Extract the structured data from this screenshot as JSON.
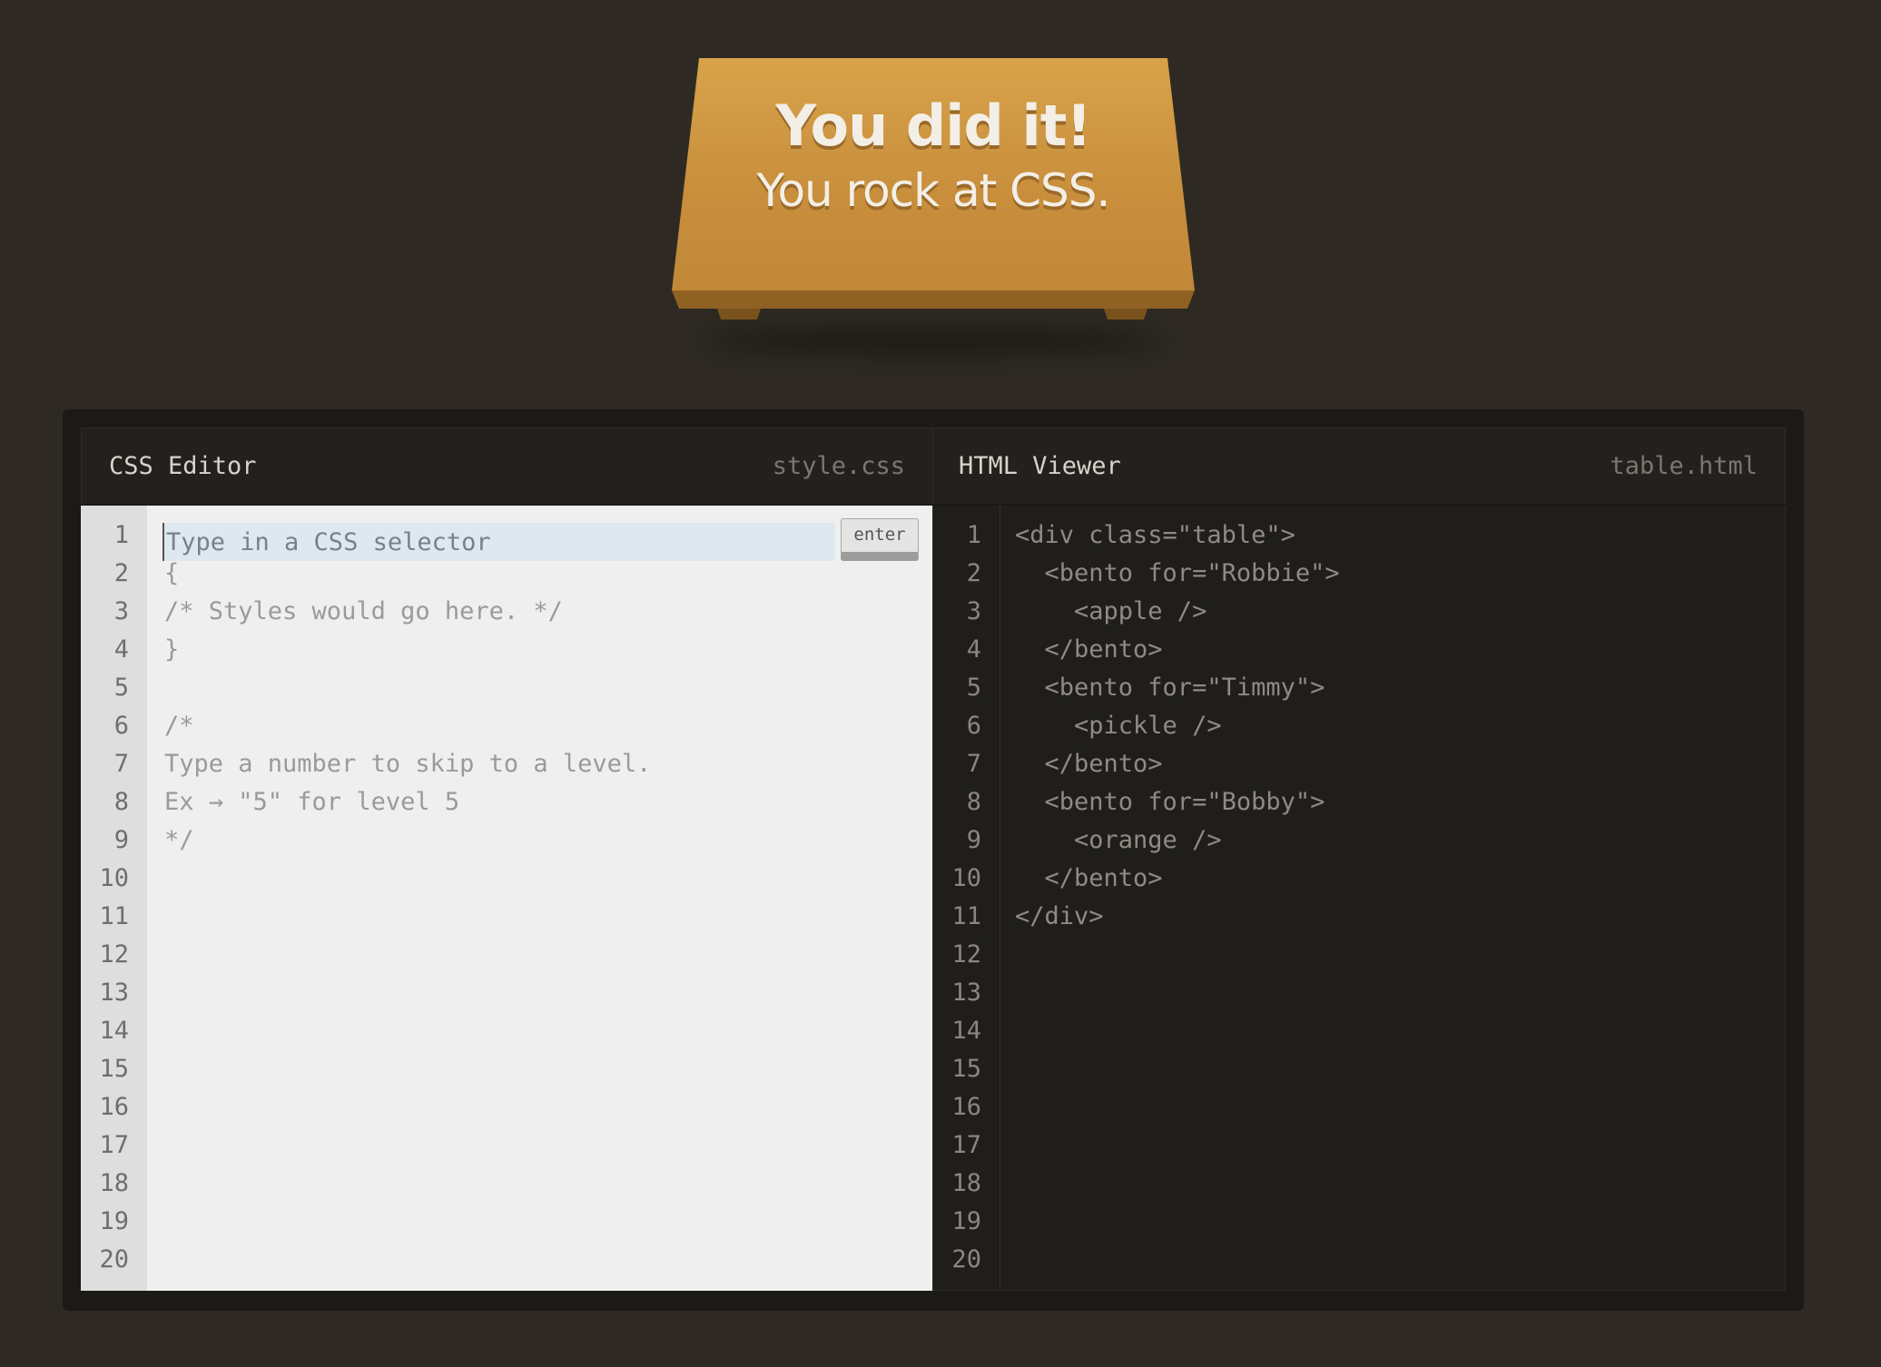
{
  "banner": {
    "title": "You did it!",
    "subtitle": "You rock at CSS."
  },
  "css_editor": {
    "title": "CSS Editor",
    "filename": "style.css",
    "input_placeholder": "Type in a CSS selector",
    "enter_label": "enter",
    "line_numbers": [
      "1",
      "2",
      "3",
      "4",
      "5",
      "6",
      "7",
      "8",
      "9",
      "10",
      "11",
      "12",
      "13",
      "14",
      "15",
      "16",
      "17",
      "18",
      "19",
      "20"
    ],
    "code_lines": [
      "",
      "{",
      "/* Styles would go here. */",
      "}",
      "",
      "/*",
      "Type a number to skip to a level.",
      "Ex → \"5\" for level 5",
      "*/"
    ]
  },
  "html_viewer": {
    "title": "HTML Viewer",
    "filename": "table.html",
    "line_numbers": [
      "1",
      "2",
      "3",
      "4",
      "5",
      "6",
      "7",
      "8",
      "9",
      "10",
      "11",
      "12",
      "13",
      "14",
      "15",
      "16",
      "17",
      "18",
      "19",
      "20"
    ],
    "code_lines": [
      "<div class=\"table\">",
      "  <bento for=\"Robbie\">",
      "    <apple />",
      "  </bento>",
      "  <bento for=\"Timmy\">",
      "    <pickle />",
      "  </bento>",
      "  <bento for=\"Bobby\">",
      "    <orange />",
      "  </bento>",
      "</div>"
    ]
  }
}
